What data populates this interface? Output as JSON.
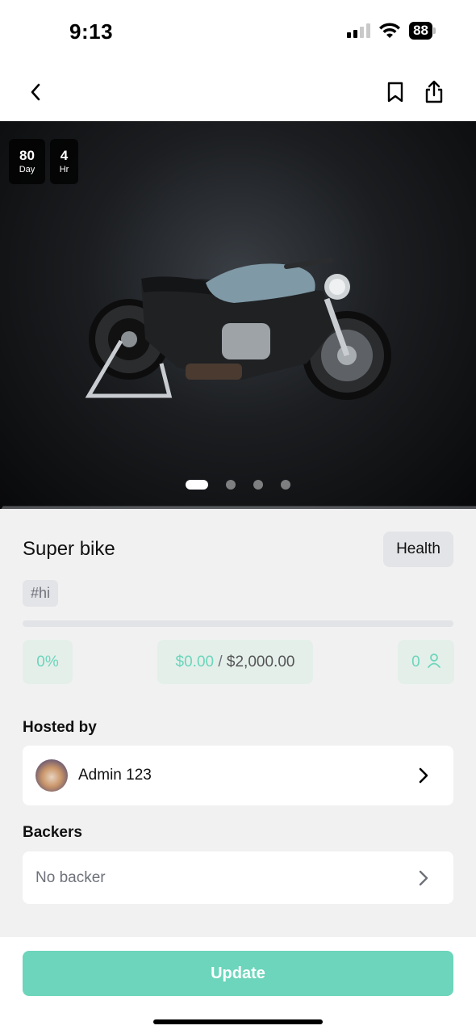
{
  "status": {
    "time": "9:13",
    "battery": "88"
  },
  "nav": {
    "back_icon": "chevron-left-icon",
    "bookmark_icon": "bookmark-icon",
    "share_icon": "share-icon"
  },
  "hero": {
    "countdown": [
      {
        "value": "80",
        "unit": "Day"
      },
      {
        "value": "4",
        "unit": "Hr"
      }
    ],
    "carousel": {
      "count": 4,
      "active_index": 0
    }
  },
  "project": {
    "title": "Super bike",
    "category": "Health",
    "tag": "#hi",
    "progress_fraction": 0,
    "percent": "0%",
    "raised": "$0.00",
    "separator": "/",
    "goal": "$2,000.00",
    "backer_count": "0"
  },
  "hosted": {
    "label": "Hosted by",
    "name": "Admin 123"
  },
  "backers": {
    "label": "Backers",
    "empty_text": "No backer"
  },
  "footer": {
    "update_label": "Update"
  },
  "colors": {
    "accent": "#6cd5bb",
    "stat_bg": "#e4efea",
    "page_bg": "#f1f1f2"
  }
}
